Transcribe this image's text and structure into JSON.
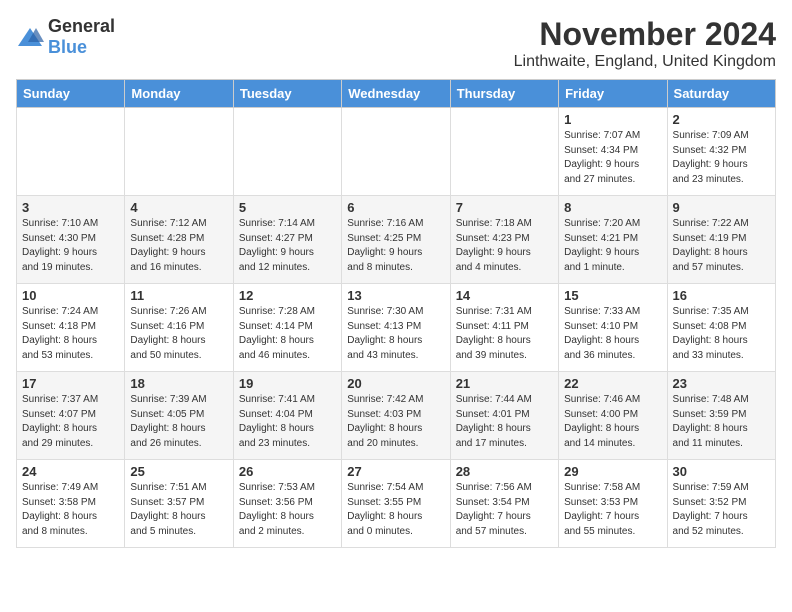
{
  "header": {
    "logo_general": "General",
    "logo_blue": "Blue",
    "month": "November 2024",
    "location": "Linthwaite, England, United Kingdom"
  },
  "weekdays": [
    "Sunday",
    "Monday",
    "Tuesday",
    "Wednesday",
    "Thursday",
    "Friday",
    "Saturday"
  ],
  "weeks": [
    [
      {
        "day": "",
        "info": ""
      },
      {
        "day": "",
        "info": ""
      },
      {
        "day": "",
        "info": ""
      },
      {
        "day": "",
        "info": ""
      },
      {
        "day": "",
        "info": ""
      },
      {
        "day": "1",
        "info": "Sunrise: 7:07 AM\nSunset: 4:34 PM\nDaylight: 9 hours\nand 27 minutes."
      },
      {
        "day": "2",
        "info": "Sunrise: 7:09 AM\nSunset: 4:32 PM\nDaylight: 9 hours\nand 23 minutes."
      }
    ],
    [
      {
        "day": "3",
        "info": "Sunrise: 7:10 AM\nSunset: 4:30 PM\nDaylight: 9 hours\nand 19 minutes."
      },
      {
        "day": "4",
        "info": "Sunrise: 7:12 AM\nSunset: 4:28 PM\nDaylight: 9 hours\nand 16 minutes."
      },
      {
        "day": "5",
        "info": "Sunrise: 7:14 AM\nSunset: 4:27 PM\nDaylight: 9 hours\nand 12 minutes."
      },
      {
        "day": "6",
        "info": "Sunrise: 7:16 AM\nSunset: 4:25 PM\nDaylight: 9 hours\nand 8 minutes."
      },
      {
        "day": "7",
        "info": "Sunrise: 7:18 AM\nSunset: 4:23 PM\nDaylight: 9 hours\nand 4 minutes."
      },
      {
        "day": "8",
        "info": "Sunrise: 7:20 AM\nSunset: 4:21 PM\nDaylight: 9 hours\nand 1 minute."
      },
      {
        "day": "9",
        "info": "Sunrise: 7:22 AM\nSunset: 4:19 PM\nDaylight: 8 hours\nand 57 minutes."
      }
    ],
    [
      {
        "day": "10",
        "info": "Sunrise: 7:24 AM\nSunset: 4:18 PM\nDaylight: 8 hours\nand 53 minutes."
      },
      {
        "day": "11",
        "info": "Sunrise: 7:26 AM\nSunset: 4:16 PM\nDaylight: 8 hours\nand 50 minutes."
      },
      {
        "day": "12",
        "info": "Sunrise: 7:28 AM\nSunset: 4:14 PM\nDaylight: 8 hours\nand 46 minutes."
      },
      {
        "day": "13",
        "info": "Sunrise: 7:30 AM\nSunset: 4:13 PM\nDaylight: 8 hours\nand 43 minutes."
      },
      {
        "day": "14",
        "info": "Sunrise: 7:31 AM\nSunset: 4:11 PM\nDaylight: 8 hours\nand 39 minutes."
      },
      {
        "day": "15",
        "info": "Sunrise: 7:33 AM\nSunset: 4:10 PM\nDaylight: 8 hours\nand 36 minutes."
      },
      {
        "day": "16",
        "info": "Sunrise: 7:35 AM\nSunset: 4:08 PM\nDaylight: 8 hours\nand 33 minutes."
      }
    ],
    [
      {
        "day": "17",
        "info": "Sunrise: 7:37 AM\nSunset: 4:07 PM\nDaylight: 8 hours\nand 29 minutes."
      },
      {
        "day": "18",
        "info": "Sunrise: 7:39 AM\nSunset: 4:05 PM\nDaylight: 8 hours\nand 26 minutes."
      },
      {
        "day": "19",
        "info": "Sunrise: 7:41 AM\nSunset: 4:04 PM\nDaylight: 8 hours\nand 23 minutes."
      },
      {
        "day": "20",
        "info": "Sunrise: 7:42 AM\nSunset: 4:03 PM\nDaylight: 8 hours\nand 20 minutes."
      },
      {
        "day": "21",
        "info": "Sunrise: 7:44 AM\nSunset: 4:01 PM\nDaylight: 8 hours\nand 17 minutes."
      },
      {
        "day": "22",
        "info": "Sunrise: 7:46 AM\nSunset: 4:00 PM\nDaylight: 8 hours\nand 14 minutes."
      },
      {
        "day": "23",
        "info": "Sunrise: 7:48 AM\nSunset: 3:59 PM\nDaylight: 8 hours\nand 11 minutes."
      }
    ],
    [
      {
        "day": "24",
        "info": "Sunrise: 7:49 AM\nSunset: 3:58 PM\nDaylight: 8 hours\nand 8 minutes."
      },
      {
        "day": "25",
        "info": "Sunrise: 7:51 AM\nSunset: 3:57 PM\nDaylight: 8 hours\nand 5 minutes."
      },
      {
        "day": "26",
        "info": "Sunrise: 7:53 AM\nSunset: 3:56 PM\nDaylight: 8 hours\nand 2 minutes."
      },
      {
        "day": "27",
        "info": "Sunrise: 7:54 AM\nSunset: 3:55 PM\nDaylight: 8 hours\nand 0 minutes."
      },
      {
        "day": "28",
        "info": "Sunrise: 7:56 AM\nSunset: 3:54 PM\nDaylight: 7 hours\nand 57 minutes."
      },
      {
        "day": "29",
        "info": "Sunrise: 7:58 AM\nSunset: 3:53 PM\nDaylight: 7 hours\nand 55 minutes."
      },
      {
        "day": "30",
        "info": "Sunrise: 7:59 AM\nSunset: 3:52 PM\nDaylight: 7 hours\nand 52 minutes."
      }
    ]
  ]
}
